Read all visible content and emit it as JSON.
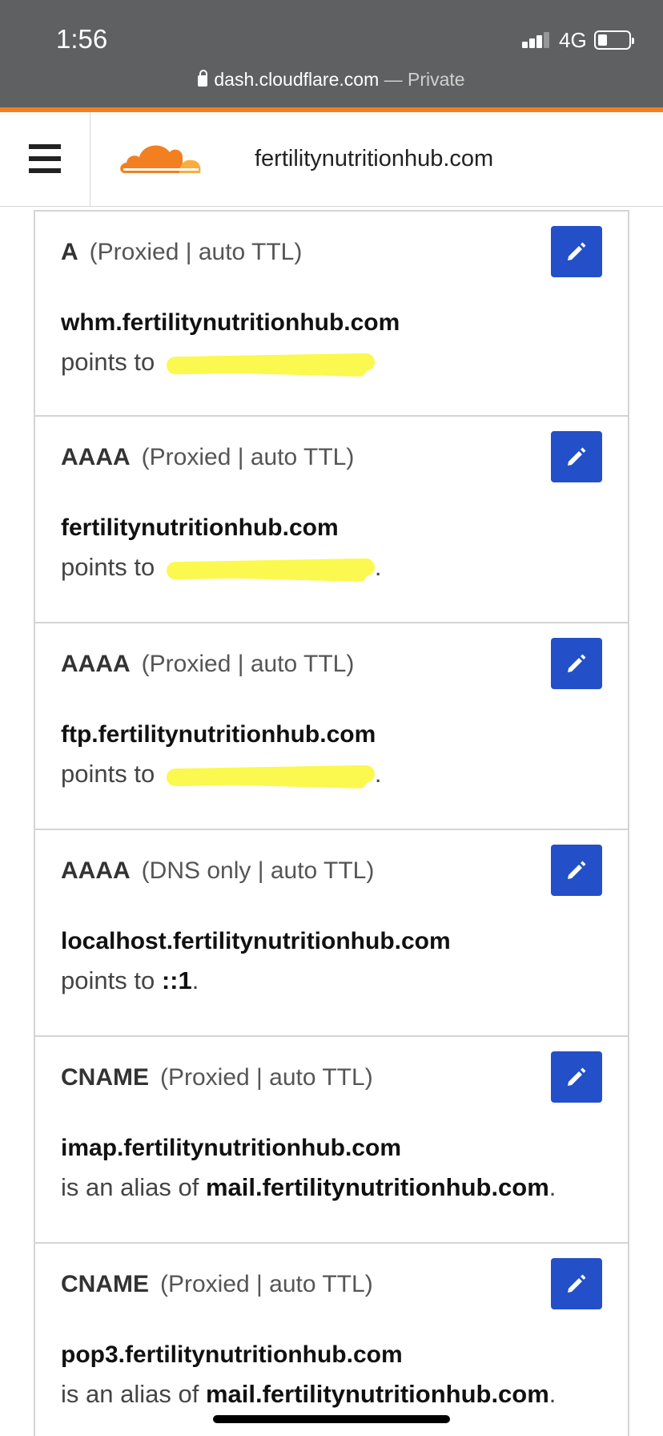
{
  "status_bar": {
    "time": "1:56",
    "network": "4G",
    "url": "dash.cloudflare.com",
    "url_separator": " — ",
    "private_label": "Private"
  },
  "header": {
    "site_name": "fertilitynutritionhub.com"
  },
  "records": [
    {
      "type": "A",
      "meta": "(Proxied | auto TTL)",
      "name": "whm.fertilitynutritionhub.com",
      "target_prefix": "points to",
      "target": "",
      "target_redacted": true,
      "target_suffix": ""
    },
    {
      "type": "AAAA",
      "meta": "(Proxied | auto TTL)",
      "name": "fertilitynutritionhub.com",
      "target_prefix": "points to",
      "target": "",
      "target_redacted": true,
      "target_suffix": "."
    },
    {
      "type": "AAAA",
      "meta": "(Proxied | auto TTL)",
      "name": "ftp.fertilitynutritionhub.com",
      "target_prefix": "points to",
      "target": "",
      "target_redacted": true,
      "target_suffix": "."
    },
    {
      "type": "AAAA",
      "meta": "(DNS only | auto TTL)",
      "name": "localhost.fertilitynutritionhub.com",
      "target_prefix": "points to",
      "target": "::1",
      "target_redacted": false,
      "target_suffix": "."
    },
    {
      "type": "CNAME",
      "meta": "(Proxied | auto TTL)",
      "name": "imap.fertilitynutritionhub.com",
      "target_prefix": "is an alias of",
      "target": "mail.fertilitynutritionhub.com",
      "target_redacted": false,
      "target_suffix": "."
    },
    {
      "type": "CNAME",
      "meta": "(Proxied | auto TTL)",
      "name": "pop3.fertilitynutritionhub.com",
      "target_prefix": "is an alias of",
      "target": "mail.fertilitynutritionhub.com",
      "target_redacted": false,
      "target_suffix": "."
    }
  ],
  "icons": {
    "menu": "hamburger-menu-icon",
    "logo": "cloudflare-logo-icon",
    "edit": "pencil-icon"
  },
  "colors": {
    "status_bar_bg": "#5f6061",
    "accent": "#f38020",
    "edit_button": "#2350c8",
    "redaction": "#fbf84f"
  }
}
